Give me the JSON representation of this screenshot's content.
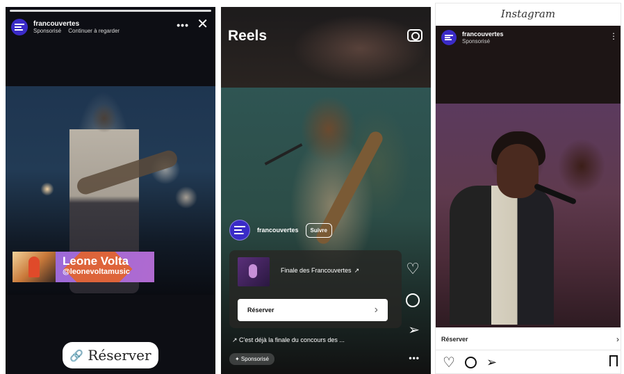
{
  "story": {
    "account": "francouvertes",
    "sponsored": "Sponsorisé",
    "continue_watching": "Continuer à regarder",
    "more": "•••",
    "close": "✕",
    "artist_name": "Leone Volta",
    "artist_handle": "@leonevoltamusic",
    "cta_label": "Réserver",
    "link_icon": "🔗"
  },
  "reels": {
    "title": "Reels",
    "account": "francouvertes",
    "follow_label": "Suivre",
    "card_title": "Finale des Francouvertes",
    "card_icon": "↗",
    "book_label": "Réserver",
    "book_chevron": "›",
    "heart": "♡",
    "share": "➢",
    "caption": "↗ C'est déjà la finale du concours des ...",
    "sponsored": "✦ Sponsorisé",
    "more": "•••"
  },
  "feed": {
    "app_logo": "Instagram",
    "account": "francouvertes",
    "sponsored": "Sponsorisé",
    "more": "⋮",
    "reserve_label": "Réserver",
    "reserve_chevron": "›",
    "heart": "♡",
    "share": "➢"
  },
  "colors": {
    "brand_avatar": "#3a2bc7",
    "story_tag_purple": "#9c6ad8",
    "story_tag_orange": "#e8631f",
    "link_blue": "#3a7bd5"
  }
}
